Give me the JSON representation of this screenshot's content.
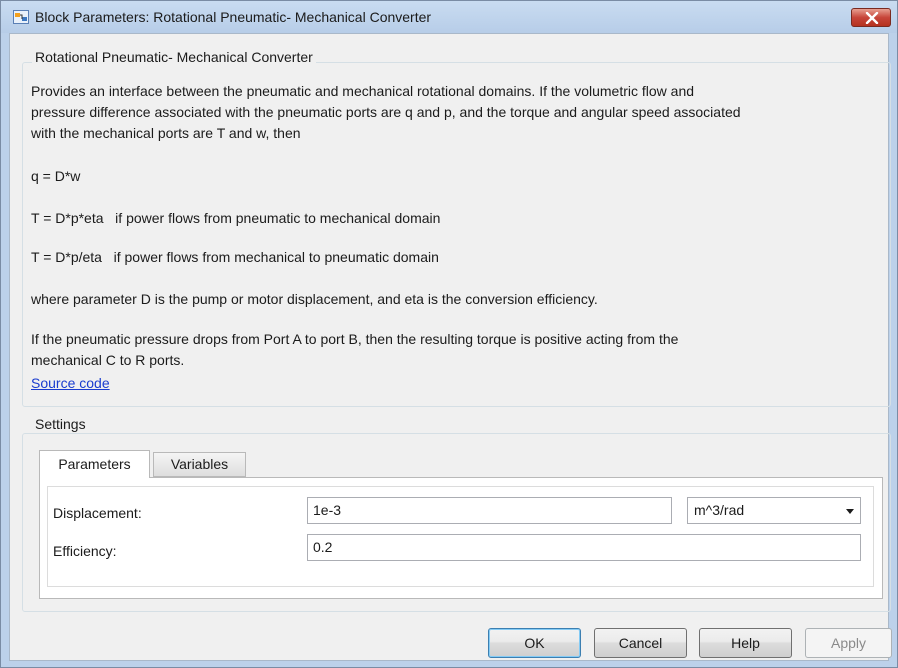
{
  "window": {
    "title": "Block Parameters: Rotational Pneumatic- Mechanical Converter"
  },
  "description_group": {
    "legend": "Rotational Pneumatic- Mechanical Converter",
    "paragraphs": [
      "Provides an interface between the pneumatic and mechanical rotational domains. If the volumetric flow and",
      "pressure difference associated with the pneumatic ports are q and p, and the torque and angular speed associated",
      "with the mechanical ports are T and w, then",
      "q = D*w",
      "T = D*p*eta   if power flows from pneumatic to mechanical domain",
      "T = D*p/eta   if power flows from mechanical to pneumatic domain",
      "where parameter D is the pump or motor displacement, and eta is the conversion efficiency.",
      "If the pneumatic pressure drops from Port A to port B, then the resulting torque is positive acting from the",
      "mechanical C to R ports."
    ],
    "link": "Source code"
  },
  "settings": {
    "legend": "Settings",
    "tabs": [
      "Parameters",
      "Variables"
    ],
    "active_tab": "Parameters",
    "params": [
      {
        "label": "Displacement:",
        "value": "1e-3",
        "unit": "m^3/rad"
      },
      {
        "label": "Efficiency:",
        "value": "0.2"
      }
    ]
  },
  "buttons": {
    "ok": "OK",
    "cancel": "Cancel",
    "help": "Help",
    "apply": "Apply"
  },
  "colors": {
    "link": "#1a3ccf",
    "close_button": "#c7453a",
    "default_button_border": "#3c7fb1"
  },
  "icons": {
    "app": "simulink-block-icon",
    "close": "close-icon",
    "dropdown": "chevron-down-icon"
  }
}
